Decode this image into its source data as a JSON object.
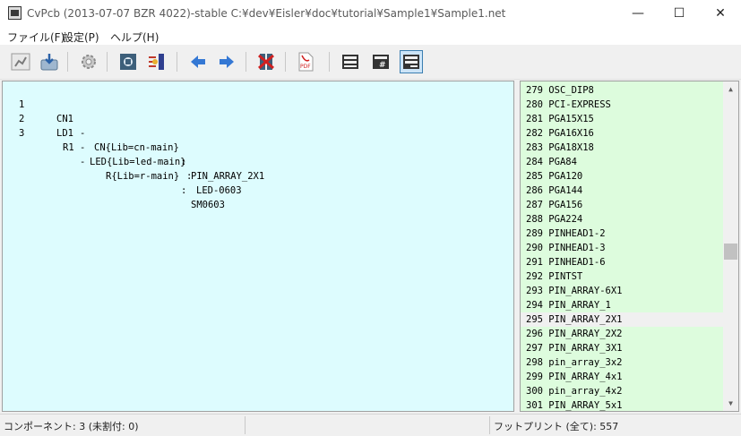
{
  "window": {
    "title": "CvPcb (2013-07-07 BZR 4022)-stable C:¥dev¥Eisler¥doc¥tutorial¥Sample1¥Sample1.net",
    "controls": {
      "minimize": "—",
      "maximize": "☐",
      "close": "✕"
    }
  },
  "menu": {
    "items": [
      "ファイル(F)",
      "設定(P)",
      "ヘルプ(H)"
    ]
  },
  "toolbar": {
    "icons": [
      "pcb-view-icon",
      "save-icon",
      "settings-icon",
      "module-library-icon",
      "auto-associate-icon",
      "arrow-left-icon",
      "arrow-right-icon",
      "delete-associations-icon",
      "pdf-icon",
      "filter-footprints-icon",
      "filter-pincount-icon",
      "filter-library-icon"
    ],
    "active": "filter-library-icon"
  },
  "components": [
    {
      "num": "1",
      "ref": "CN1",
      "value": "CN{Lib=cn-main}",
      "footprint": "PIN_ARRAY_2X1"
    },
    {
      "num": "2",
      "ref": "LD1",
      "value": "LED{Lib=led-main}",
      "footprint": "LED-0603"
    },
    {
      "num": "3",
      "ref": "R1",
      "value": "R{Lib=r-main}",
      "footprint": "SM0603"
    }
  ],
  "footprints": [
    {
      "num": "279",
      "name": "OSC_DIP8"
    },
    {
      "num": "280",
      "name": "PCI-EXPRESS"
    },
    {
      "num": "281",
      "name": "PGA15X15"
    },
    {
      "num": "282",
      "name": "PGA16X16"
    },
    {
      "num": "283",
      "name": "PGA18X18"
    },
    {
      "num": "284",
      "name": "PGA84"
    },
    {
      "num": "285",
      "name": "PGA120"
    },
    {
      "num": "286",
      "name": "PGA144"
    },
    {
      "num": "287",
      "name": "PGA156"
    },
    {
      "num": "288",
      "name": "PGA224"
    },
    {
      "num": "289",
      "name": "PINHEAD1-2"
    },
    {
      "num": "290",
      "name": "PINHEAD1-3"
    },
    {
      "num": "291",
      "name": "PINHEAD1-6"
    },
    {
      "num": "292",
      "name": "PINTST"
    },
    {
      "num": "293",
      "name": "PIN_ARRAY-6X1"
    },
    {
      "num": "294",
      "name": "PIN_ARRAY_1"
    },
    {
      "num": "295",
      "name": "PIN_ARRAY_2X1"
    },
    {
      "num": "296",
      "name": "PIN_ARRAY_2X2"
    },
    {
      "num": "297",
      "name": "PIN_ARRAY_3X1"
    },
    {
      "num": "298",
      "name": "pin_array_3x2"
    },
    {
      "num": "299",
      "name": "PIN_ARRAY_4x1"
    },
    {
      "num": "300",
      "name": "pin_array_4x2"
    },
    {
      "num": "301",
      "name": "PIN_ARRAY_5x1"
    }
  ],
  "selected_footprint": "295",
  "status": {
    "components": "コンポーネント: 3 (未割付: 0)",
    "middle": "",
    "footprints": "フットプリント (全て): 557"
  },
  "colors": {
    "components_bg": "#ddfcfe",
    "footprints_bg": "#ddfcdd",
    "selection_bg": "#f0f0f0",
    "active_button": "#cce4f7"
  }
}
